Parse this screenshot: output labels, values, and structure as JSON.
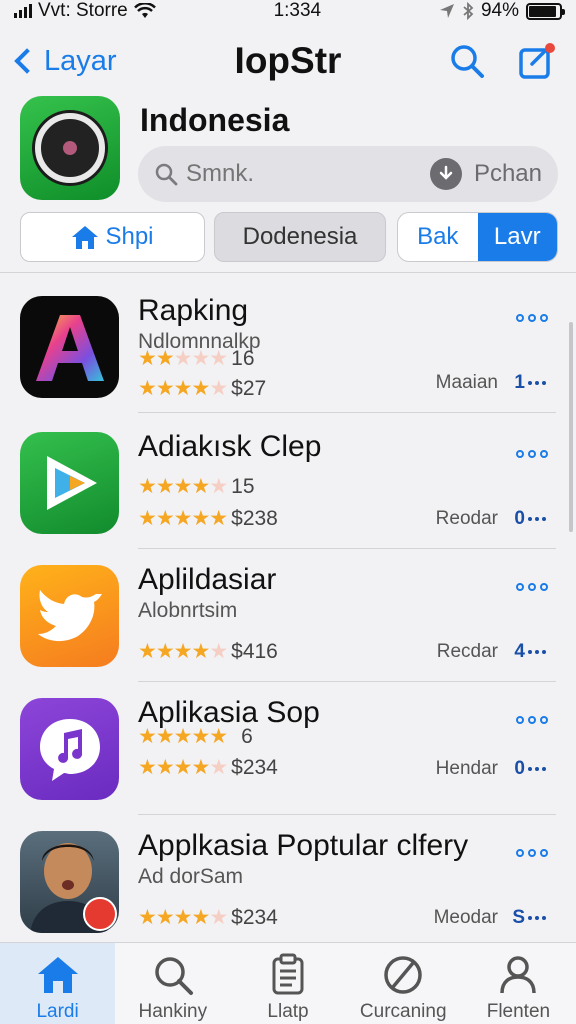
{
  "status": {
    "carrier": "Vvt: Storre",
    "time": "1:334",
    "battery": "94%"
  },
  "nav": {
    "back_label": "Layar",
    "title": "IopStr"
  },
  "header": {
    "title": "Indonesia",
    "search_placeholder": "Smnk.",
    "search_action": "Pchan"
  },
  "segments": {
    "home": "Shpi",
    "middle": "Dodenesia",
    "left_pair": "Bak",
    "right_pair": "Lavr"
  },
  "apps": [
    {
      "name": "Rapking",
      "sub": "Ndlomnnalkp",
      "rating1": "16",
      "rating2": "$27",
      "right_label": "Maaian",
      "right_num": "1"
    },
    {
      "name": "Adiakısk Clep",
      "sub": "",
      "rating1": "15",
      "rating2": "$238",
      "right_label": "Reodar",
      "right_num": "0"
    },
    {
      "name": "Aplildasiar",
      "sub": "Alobnrtsim",
      "rating1": "",
      "rating2": "$416",
      "right_label": "Recdar",
      "right_num": "4"
    },
    {
      "name": "Aplikasia Sop",
      "sub": "",
      "rating1": "6",
      "rating2": "$234",
      "right_label": "Hendar",
      "right_num": "0"
    },
    {
      "name": "Applkasia Poptular clfery",
      "sub": "Ad dorSam",
      "rating1": "",
      "rating2": "$234",
      "right_label": "Meodar",
      "right_num": "S"
    }
  ],
  "tabs": [
    {
      "label": "Lardi",
      "icon": "home-icon"
    },
    {
      "label": "Hankiny",
      "icon": "search-icon"
    },
    {
      "label": "Llatp",
      "icon": "clipboard-icon"
    },
    {
      "label": "Curcaning",
      "icon": "no-symbol-icon"
    },
    {
      "label": "Flenten",
      "icon": "person-icon"
    }
  ],
  "colors": {
    "accent": "#1a7ce8",
    "star": "#f5a623"
  }
}
